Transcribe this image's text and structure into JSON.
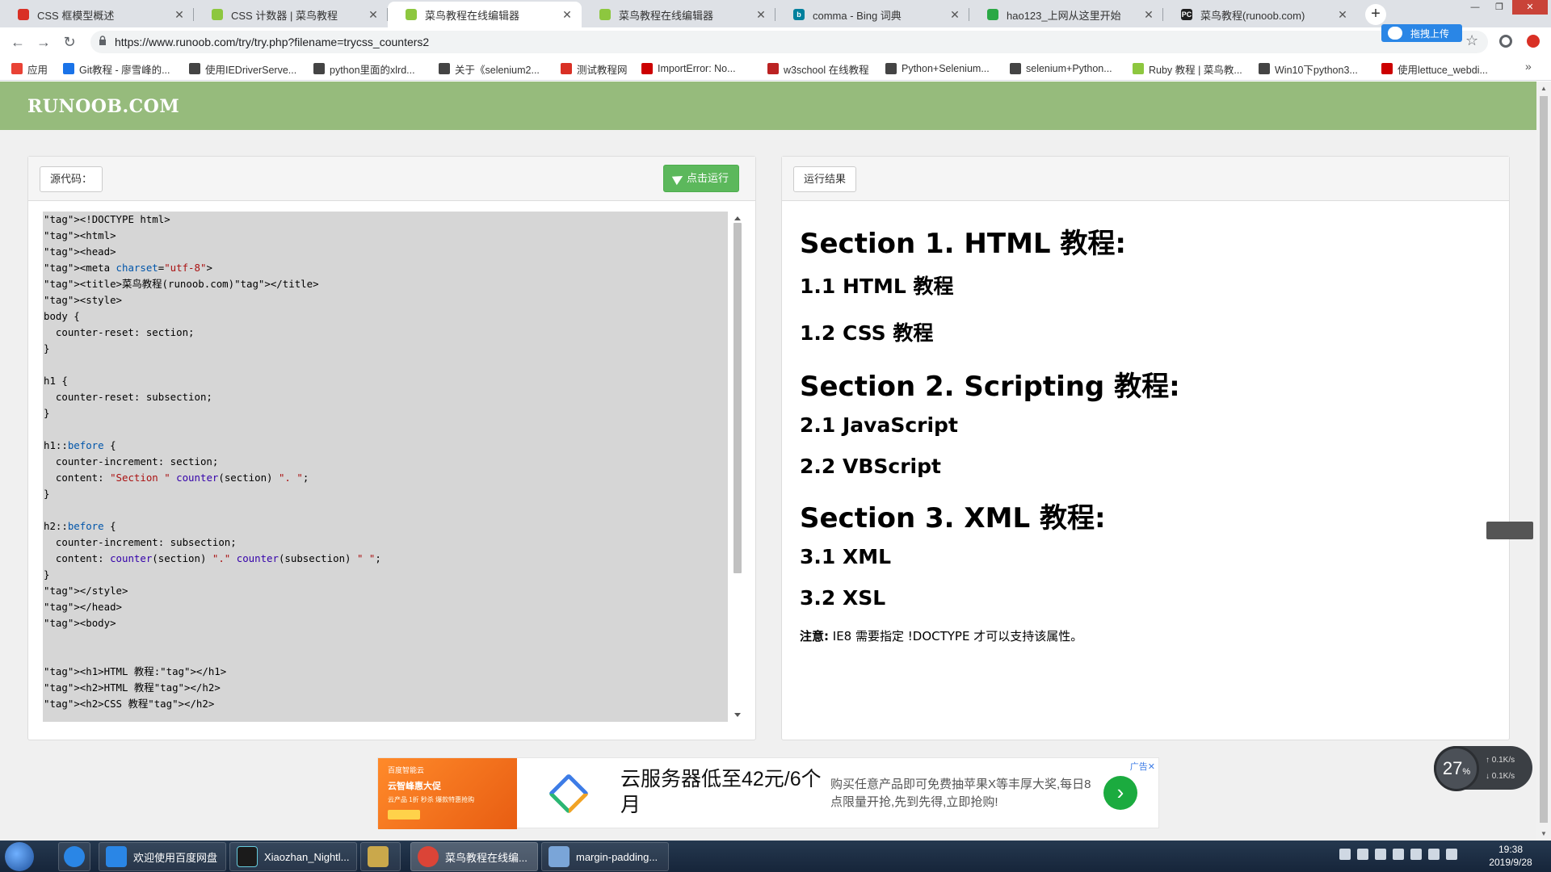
{
  "browser": {
    "tabs": [
      {
        "label": "CSS 框模型概述",
        "favicon_color": "#d93025"
      },
      {
        "label": "CSS 计数器 | 菜鸟教程",
        "favicon_color": "#8dc73f"
      },
      {
        "label": "菜鸟教程在线编辑器",
        "favicon_color": "#8dc73f",
        "active": true
      },
      {
        "label": "菜鸟教程在线编辑器",
        "favicon_color": "#8dc73f"
      },
      {
        "label": "comma - Bing 词典",
        "favicon_color": "#00809d"
      },
      {
        "label": "hao123_上网从这里开始",
        "favicon_color": "#2aa845"
      },
      {
        "label": "菜鸟教程(runoob.com)",
        "favicon_color": "#1e1e1e"
      }
    ],
    "url": "https://www.runoob.com/try/try.php?filename=trycss_counters2",
    "baidu_upload_label": "拖拽上传",
    "bookmarks": [
      {
        "label": "应用",
        "color": "#e94235"
      },
      {
        "label": "Git教程 - 廖雪峰的...",
        "color": "#1a73e8"
      },
      {
        "label": "使用IEDriverServe...",
        "color": "#444"
      },
      {
        "label": "python里面的xlrd...",
        "color": "#444"
      },
      {
        "label": "关于《selenium2...",
        "color": "#444"
      },
      {
        "label": "测试教程网",
        "color": "#d93025"
      },
      {
        "label": "ImportError: No...",
        "color": "#c00"
      },
      {
        "label": "w3school 在线教程",
        "color": "#b22"
      },
      {
        "label": "Python+Selenium...",
        "color": "#444"
      },
      {
        "label": "selenium+Python...",
        "color": "#444"
      },
      {
        "label": "Ruby 教程 | 菜鸟教...",
        "color": "#8dc73f"
      },
      {
        "label": "Win10下python3...",
        "color": "#444"
      },
      {
        "label": "使用lettuce_webdi...",
        "color": "#c00"
      }
    ],
    "more": "»"
  },
  "site": {
    "logo": "RUNOOB.COM",
    "header_color": "#96bb7c"
  },
  "editor": {
    "source_label": "源代码：",
    "run_label": "点击运行",
    "result_label": "运行结果"
  },
  "code_lines": [
    "<!DOCTYPE html>",
    "<html>",
    "<head>",
    "<meta charset=\"utf-8\">",
    "<title>菜鸟教程(runoob.com)</title>",
    "<style>",
    "body {",
    "  counter-reset: section;",
    "}",
    "",
    "h1 {",
    "  counter-reset: subsection;",
    "}",
    "",
    "h1::before {",
    "  counter-increment: section;",
    "  content: \"Section \" counter(section) \". \";",
    "}",
    "",
    "h2::before {",
    "  counter-increment: subsection;",
    "  content: counter(section) \".\" counter(subsection) \" \";",
    "}",
    "</style>",
    "</head>",
    "<body>",
    "",
    "",
    "<h1>HTML 教程:</h1>",
    "<h2>HTML 教程</h2>",
    "<h2>CSS 教程</h2>"
  ],
  "result": {
    "items": [
      {
        "level": 1,
        "text": "Section 1. HTML 教程:"
      },
      {
        "level": 2,
        "text": "1.1 HTML 教程"
      },
      {
        "level": 2,
        "text": "1.2 CSS 教程"
      },
      {
        "level": 1,
        "text": "Section 2. Scripting 教程:"
      },
      {
        "level": 2,
        "text": "2.1 JavaScript"
      },
      {
        "level": 2,
        "text": "2.2 VBScript"
      },
      {
        "level": 1,
        "text": "Section 3. XML 教程:"
      },
      {
        "level": 2,
        "text": "3.1 XML"
      },
      {
        "level": 2,
        "text": "3.2 XSL"
      }
    ],
    "note_bold": "注意:",
    "note_text": " IE8 需要指定 !DOCTYPE 才可以支持该属性。"
  },
  "ad": {
    "img_line1": "百度智能云",
    "img_line2": "云智峰惠大促",
    "img_line3": "云产品 1折 秒杀 爆款特惠抢购",
    "title": "云服务器低至42元/6个月",
    "desc": "购买任意产品即可免费抽苹果X等丰厚大奖,每日8点限量开抢,先到先得,立即抢购!",
    "label": "广告✕",
    "go": "›"
  },
  "netmeter": {
    "percent": "27",
    "percent_sign": "%",
    "up": "0.1K/s",
    "down": "0.1K/s"
  },
  "taskbar": {
    "items": [
      {
        "label": "欢迎使用百度网盘",
        "color": "#2a86e6"
      },
      {
        "label": "Xiaozhan_Nightl...",
        "color": "#1b1b1b"
      },
      {
        "label": "",
        "color": "#caa84b"
      },
      {
        "label": "菜鸟教程在线编...",
        "color": "#db4437",
        "active": true
      },
      {
        "label": "margin-padding...",
        "color": "#7aa5d8"
      }
    ],
    "time": "19:38",
    "date": "2019/9/28"
  }
}
